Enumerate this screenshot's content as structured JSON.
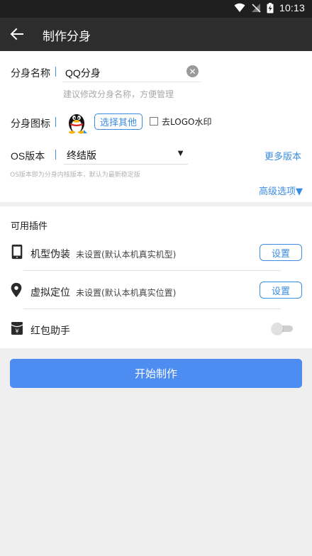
{
  "status_bar": {
    "time": "10:13",
    "icons": [
      "wifi-icon",
      "signal-off-icon",
      "battery-charging-icon"
    ]
  },
  "app_bar": {
    "title": "制作分身",
    "back_icon": "arrow-left-icon"
  },
  "form": {
    "name_label": "分身名称",
    "name_value": "QQ分身",
    "name_hint": "建议修改分身名称，方便管理",
    "icon_label": "分身图标",
    "choose_other_label": "选择其他",
    "remove_logo_label": "去LOGO水印",
    "remove_logo_checked": false,
    "os_label": "OS版本",
    "os_value": "终结版",
    "more_versions_label": "更多版本",
    "os_hint": "OS版本即为分身内核版本，默认为最新稳定版",
    "advanced_label": "高级选项▼"
  },
  "plugins": {
    "section_title": "可用插件",
    "items": [
      {
        "name": "机型伪装",
        "status": "未设置(默认本机真实机型)",
        "button": "设置",
        "icon": "phone-icon"
      },
      {
        "name": "虚拟定位",
        "status": "未设置(默认本机真实位置)",
        "button": "设置",
        "icon": "location-pin-icon"
      },
      {
        "name": "红包助手",
        "icon": "red-envelope-icon",
        "enabled": false
      }
    ]
  },
  "start_button_label": "开始制作",
  "colors": {
    "accent": "#3b8ce0",
    "primary_button": "#4d8cf0",
    "app_bar": "#2d2d2d",
    "status_bar": "#1f1f1f"
  }
}
